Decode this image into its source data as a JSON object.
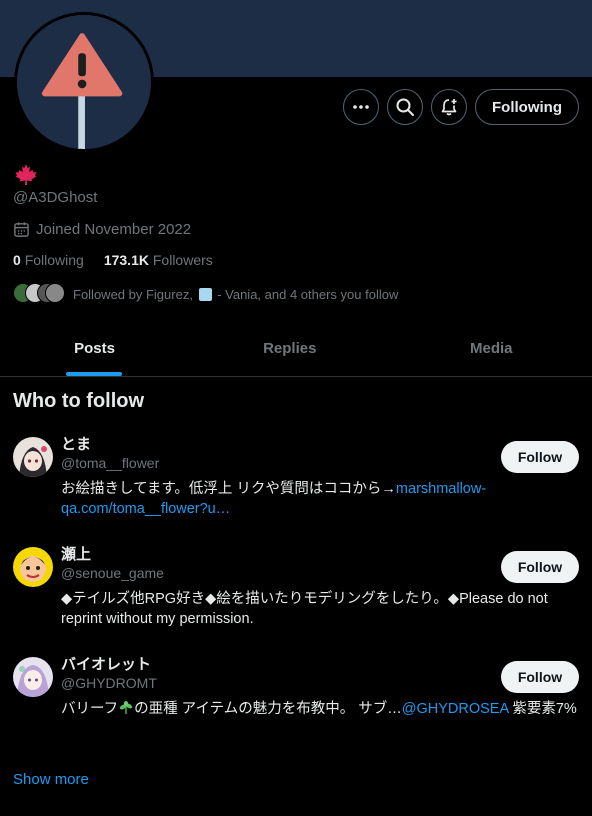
{
  "profile": {
    "handle": "@A3DGhost",
    "joined": "Joined November 2022",
    "following_count": "0",
    "following_label": "Following",
    "followers_count": "173.1K",
    "followers_label": "Followers",
    "followed_by_prefix": "Followed by Figurez,",
    "followed_by_suffix": "- Vania, and 4 others you follow"
  },
  "actions": {
    "more_icon": "more-icon",
    "search_icon": "search-icon",
    "notify_icon": "bell-plus-icon",
    "following_label": "Following"
  },
  "tabs": [
    {
      "label": "Posts"
    },
    {
      "label": "Replies"
    },
    {
      "label": "Media"
    }
  ],
  "who_to_follow": {
    "title": "Who to follow",
    "users": [
      {
        "name": "とま",
        "handle": "@toma__flower",
        "bio_text": "お絵描きしてます。低浮上 リクや質問はココから→",
        "bio_link": "marshmallow-qa.com/toma__flower?u…",
        "follow_label": "Follow"
      },
      {
        "name": "瀬上",
        "handle": "@senoue_game",
        "bio_text": "◆テイルズ他RPG好き◆絵を描いたりモデリングをしたり。◆Please do not reprint without my permission.",
        "follow_label": "Follow"
      },
      {
        "name": "バイオレット",
        "handle": "@GHYDROMT",
        "bio_text": "バリーフ",
        "bio_text2": "の亜種 アイテムの魅力を布教中。 サブ…",
        "bio_link": "@GHYDROSEA",
        "bio_text3": " 紫要素7%",
        "follow_label": "Follow"
      }
    ],
    "show_more": "Show more"
  },
  "colors": {
    "accent": "#1d9bf0",
    "banner": "#1e2d46",
    "warning_red": "#e0776a",
    "flag_red": "#e0245e"
  }
}
